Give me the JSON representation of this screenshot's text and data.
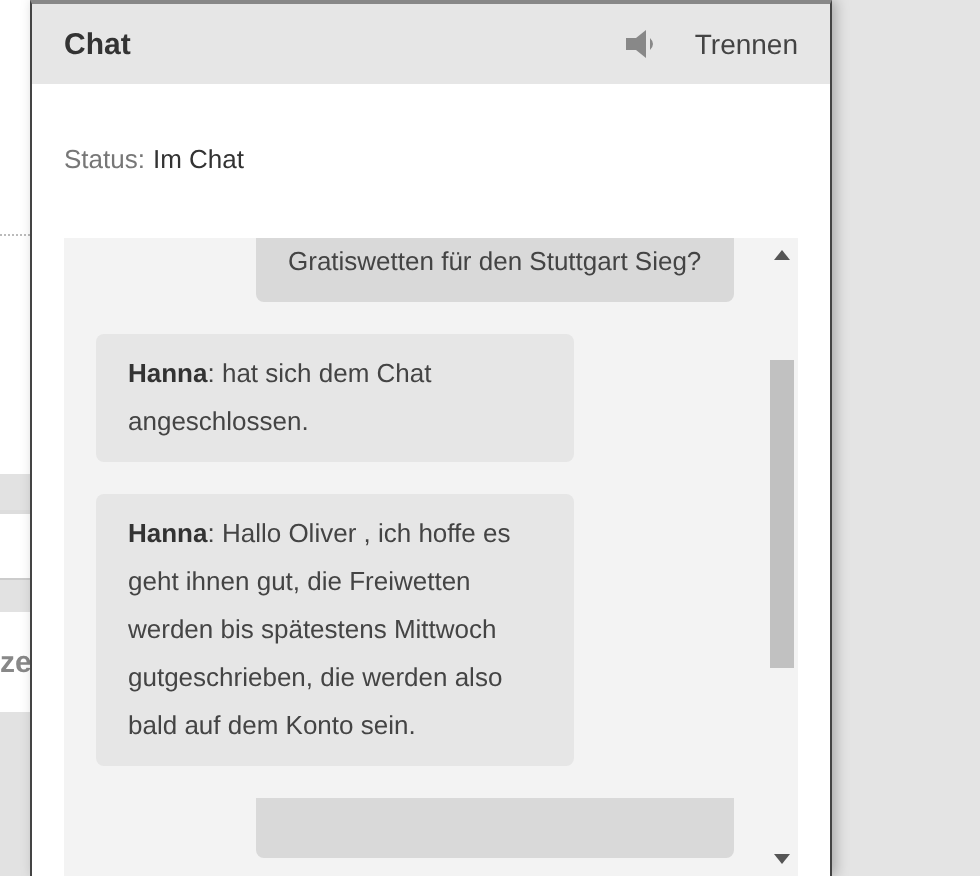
{
  "background_fragment": {
    "text": "ze"
  },
  "chat": {
    "title": "Chat",
    "disconnect_label": "Trennen",
    "status_label": "Status:",
    "status_value": "Im Chat",
    "messages": [
      {
        "kind": "own",
        "text": "Gratiswetten für den Stuttgart Sieg?"
      },
      {
        "kind": "agent",
        "sender": "Hanna",
        "text": ": hat sich dem Chat angeschlossen."
      },
      {
        "kind": "agent",
        "sender": "Hanna",
        "text": ": Hallo Oliver , ich hoffe es geht ihnen gut, die Freiwetten werden bis spätestens Mittwoch gutgeschrieben, die werden also bald auf dem Konto sein."
      },
      {
        "kind": "own"
      }
    ]
  }
}
